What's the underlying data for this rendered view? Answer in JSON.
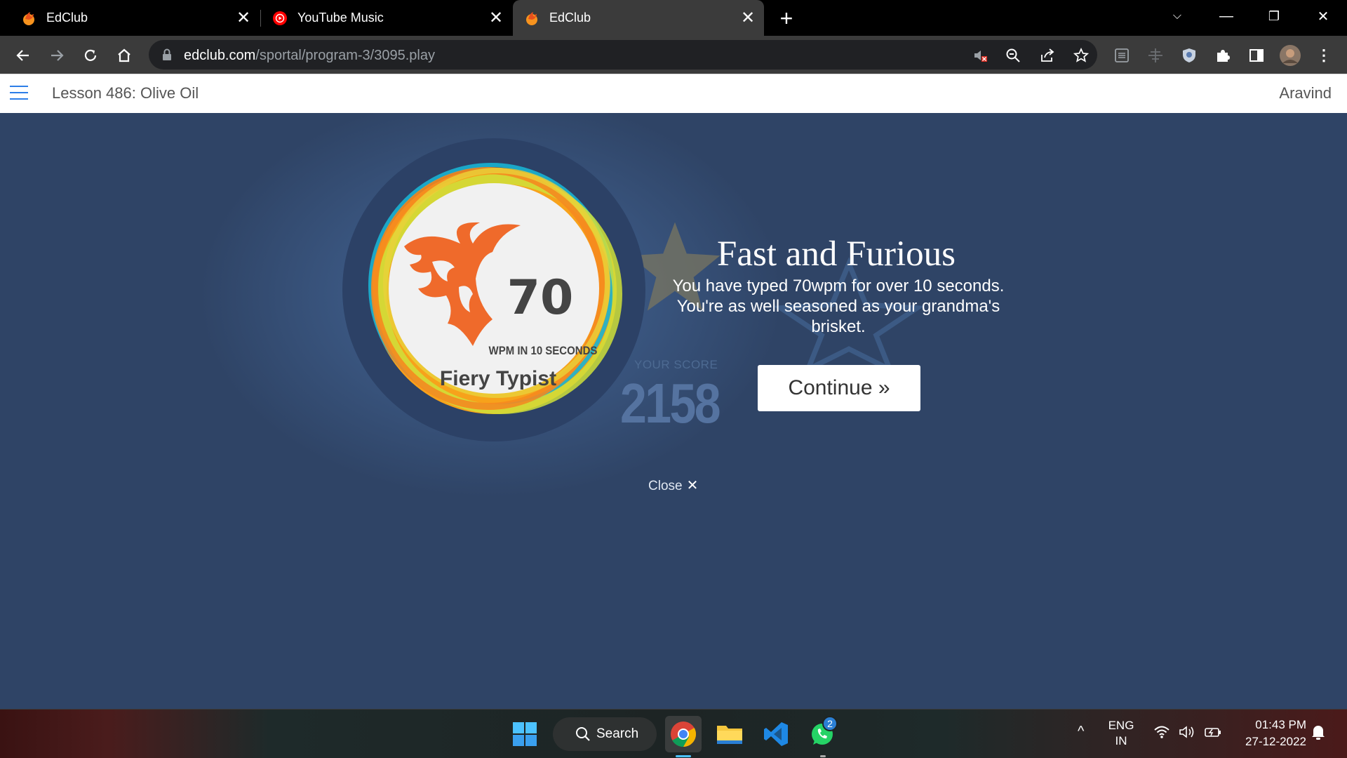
{
  "browser": {
    "tabs": [
      {
        "title": "EdClub",
        "active": false
      },
      {
        "title": "YouTube Music",
        "active": false
      },
      {
        "title": "EdClub",
        "active": true
      }
    ],
    "url_host": "edclub.com",
    "url_path": "/sportal/program-3/3095.play"
  },
  "page": {
    "lesson_title": "Lesson 486: Olive Oil",
    "user_name": "Aravind"
  },
  "badge": {
    "number": "70",
    "subtitle": "WPM IN 10 SECONDS",
    "name": "Fiery Typist"
  },
  "score": {
    "label": "YOUR SCORE",
    "value": "2158"
  },
  "achievement": {
    "title": "Fast and Furious",
    "message_line1": "You have typed 70wpm for over 10 seconds.",
    "message_line2": "You're as well seasoned as your grandma's brisket."
  },
  "buttons": {
    "continue_label": "Continue »",
    "close_label": "Close",
    "close_glyph": "✕"
  },
  "taskbar": {
    "search_label": "Search",
    "whatsapp_badge": "2",
    "lang_line1": "ENG",
    "lang_line2": "IN",
    "time": "01:43 PM",
    "date": "27-12-2022"
  },
  "colors": {
    "page_bg": "#2f4466",
    "accent_blue": "#2d7ee8",
    "flame_orange": "#ef6a2b"
  }
}
